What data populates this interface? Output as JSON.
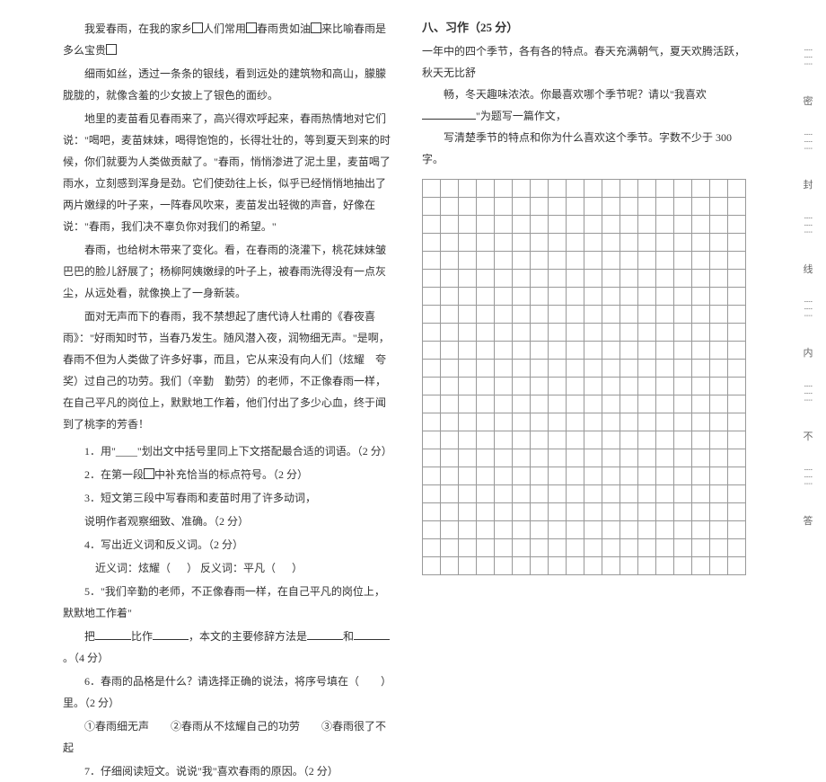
{
  "passage": {
    "p1": "我爱春雨，在我的家乡□人们常用□春雨贵如油□来比喻春雨是多么宝贵□",
    "p2": "细雨如丝，透过一条条的银线，看到远处的建筑物和高山，朦朦胧胧的，就像含羞的少女披上了银色的面纱。",
    "p3": "地里的麦苗看见春雨来了，高兴得欢呼起来，春雨热情地对它们说：\"喝吧，麦苗妹妹，喝得饱饱的，长得壮壮的，等到夏天到来的时候，你们就要为人类做贡献了。\"春雨，悄悄渗进了泥土里，麦苗喝了雨水，立刻感到浑身是劲。它们使劲往上长，似乎已经悄悄地抽出了两片嫩绿的叶子来，一阵春风吹来，麦苗发出轻微的声音，好像在说：\"春雨，我们决不辜负你对我们的希望。\"",
    "p4": "春雨，也给树木带来了变化。看，在春雨的浇灌下，桃花妹妹皱巴巴的脸儿舒展了；杨柳阿姨嫩绿的叶子上，被春雨洗得没有一点灰尘，从远处看，就像换上了一身新装。",
    "p5": "面对无声而下的春雨，我不禁想起了唐代诗人杜甫的《春夜喜雨》：\"好雨知时节，当春乃发生。随风潜入夜，润物细无声。\"是啊，春雨不但为人类做了许多好事，而且，它从来没有向人们（炫耀　夸奖）过自己的功劳。我们（辛勤　勤劳）的老师，不正像春雨一样，在自己平凡的岗位上，默默地工作着，他们付出了多少心血，终于闻到了桃李的芳香！"
  },
  "questions": {
    "q1": "1．用\"____\"划出文中括号里同上下文搭配最合适的词语。（2 分）",
    "q2": "2．在第一段□中补充恰当的标点符号。（2 分）",
    "q3": "3．短文第三段中写春雨和麦苗时用了许多动词，",
    "q3b": "说明作者观察细致、准确。（2 分）",
    "q4": "4．写出近义词和反义词。（2 分）",
    "q4b_left": "近义词：炫耀（",
    "q4b_mid": "）          反义词：平凡（",
    "q4b_right": "）",
    "q5": "5．\"我们辛勤的老师，不正像春雨一样，在自己平凡的岗位上，默默地工作着\"",
    "q5b_a": "把",
    "q5b_b": "比作",
    "q5b_c": "，本文的主要修辞方法是",
    "q5b_d": "和",
    "q5b_e": "。（4 分）",
    "q6": "6．春雨的品格是什么？请选择正确的说法，将序号填在（　　）里。（2 分）",
    "q6opts": "①春雨细无声　　②春雨从不炫耀自己的功劳　　③春雨很了不起",
    "q7": "7．仔细阅读短文。说说\"我\"喜欢春雨的原因。（2 分）"
  },
  "section8": {
    "title": "八、习作（25 分）",
    "line1": "一年中的四个季节，各有各的特点。春天充满朝气，夏天欢腾活跃，秋天无比舒",
    "line2": "畅，冬天趣味浓浓。你最喜欢哪个季节呢？请以\"我喜欢________\"为题写一篇作文，",
    "line3": "写清楚季节的特点和你为什么喜欢这个季节。字数不少于 300 字。"
  },
  "grid": {
    "rows": 22,
    "cols": 18
  },
  "side": {
    "m1": "密",
    "m2": "封",
    "m3": "线",
    "m4": "内",
    "m5": "不",
    "m6": "答"
  }
}
